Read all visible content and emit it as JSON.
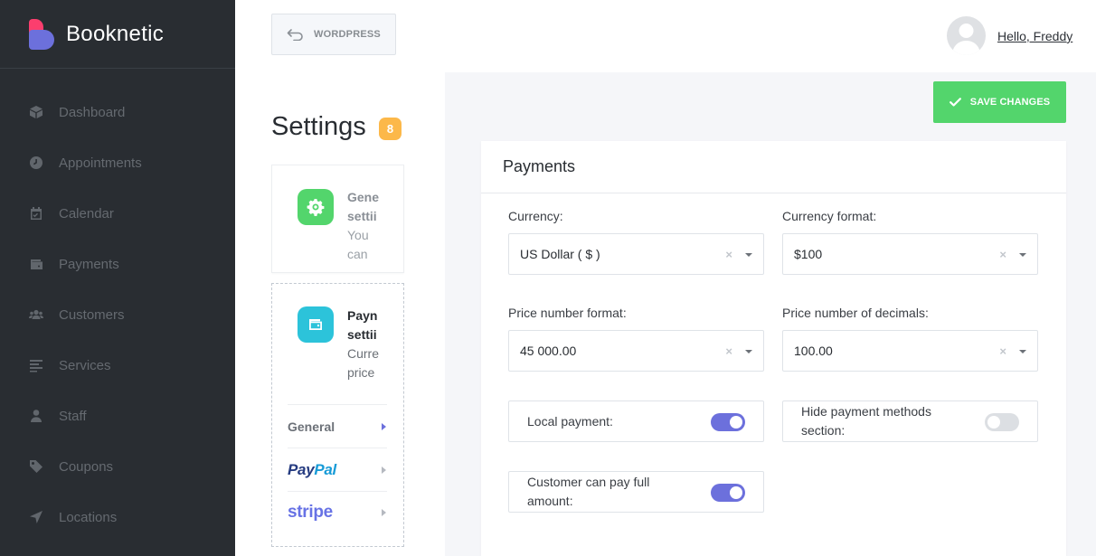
{
  "brand": {
    "name": "Booknetic"
  },
  "sidebar": {
    "items": [
      {
        "label": "Dashboard",
        "icon": "cube-icon"
      },
      {
        "label": "Appointments",
        "icon": "clock-icon"
      },
      {
        "label": "Calendar",
        "icon": "calendar-icon"
      },
      {
        "label": "Payments",
        "icon": "wallet-icon"
      },
      {
        "label": "Customers",
        "icon": "users-icon"
      },
      {
        "label": "Services",
        "icon": "list-icon"
      },
      {
        "label": "Staff",
        "icon": "user-icon"
      },
      {
        "label": "Coupons",
        "icon": "tag-icon"
      },
      {
        "label": "Locations",
        "icon": "location-arrow-icon"
      }
    ]
  },
  "header": {
    "wordpress_label": "WORDPRESS",
    "greeting": "Hello, Freddy"
  },
  "settings": {
    "title": "Settings",
    "count": "8",
    "cards": [
      {
        "title_l1": "Gene",
        "title_l2": "settii",
        "desc_l1": "You",
        "desc_l2": "can"
      },
      {
        "title_l1": "Payn",
        "title_l2": "settii",
        "desc_l1": "Curre",
        "desc_l2": "price"
      }
    ],
    "payment_sub": {
      "general": "General",
      "paypal_pay": "Pay",
      "paypal_pal": "Pal",
      "stripe": "stripe"
    }
  },
  "actions": {
    "save_label": "SAVE CHANGES"
  },
  "panel": {
    "title": "Payments",
    "fields": {
      "currency": {
        "label": "Currency:",
        "value": "US Dollar ( $ )"
      },
      "currency_format": {
        "label": "Currency format:",
        "value": "$100"
      },
      "price_number_format": {
        "label": "Price number format:",
        "value": "45 000.00"
      },
      "price_decimals": {
        "label": "Price number of decimals:",
        "value": "100.00"
      }
    },
    "toggles": {
      "local_payment": {
        "label": "Local payment:",
        "on": true
      },
      "hide_methods": {
        "label_l1": "Hide payment methods",
        "label_l2": "section:",
        "on": false
      },
      "pay_full": {
        "label_l1": "Customer can pay full",
        "label_l2": "amount:",
        "on": true
      }
    }
  },
  "colors": {
    "sidebar_bg": "#292d32",
    "accent": "#6c70dc",
    "success": "#53d56c",
    "badge": "#fcb849"
  }
}
